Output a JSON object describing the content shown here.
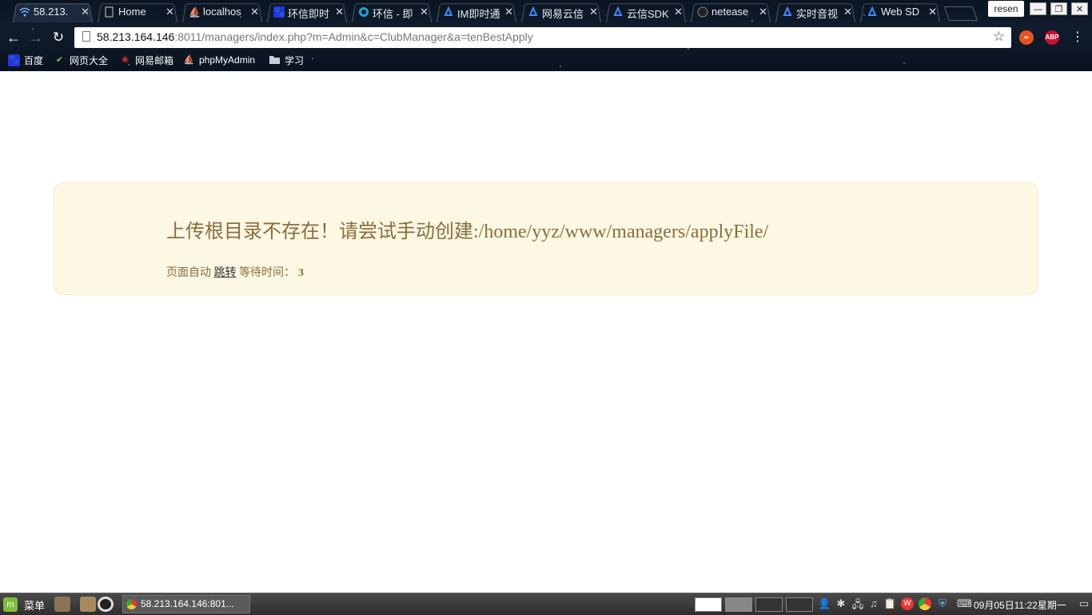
{
  "browser": {
    "tabs": [
      {
        "label": "58.213.",
        "icon": "wifi-icon",
        "active": true
      },
      {
        "label": "Home",
        "icon": "page-icon"
      },
      {
        "label": "localhos",
        "icon": "phpmyadmin-icon"
      },
      {
        "label": "环信即时",
        "icon": "paw-icon"
      },
      {
        "label": "环信 - 即",
        "icon": "easemob-icon"
      },
      {
        "label": "IM即时通",
        "icon": "netease-icon"
      },
      {
        "label": "网易云信",
        "icon": "netease-icon"
      },
      {
        "label": "云信SDK",
        "icon": "netease-icon"
      },
      {
        "label": "netease",
        "icon": "github-icon"
      },
      {
        "label": "实时音视",
        "icon": "netease-icon"
      },
      {
        "label": "Web SD",
        "icon": "netease-icon"
      }
    ],
    "user_label": "resen",
    "url_host": "58.213.164.146",
    "url_rest": ":8011/managers/index.php?m=Admin&c=ClubManager&a=tenBestApply",
    "bookmarks": [
      {
        "label": "百度",
        "icon": "baidu-icon"
      },
      {
        "label": "网页大全",
        "icon": "hao-icon"
      },
      {
        "label": "网易邮箱",
        "icon": "netease-mail-icon"
      },
      {
        "label": "phpMyAdmin",
        "icon": "phpmyadmin-icon"
      },
      {
        "label": "学习",
        "icon": "folder-icon"
      }
    ],
    "extensions": [
      "infinity-extension-icon",
      "adblock-plus-icon"
    ],
    "adblock_label": "ABP"
  },
  "page": {
    "message": "上传根目录不存在！请尝试手动创建:/home/yyz/www/managers/applyFile/",
    "redirect_prefix": "页面自动",
    "redirect_link": "跳转",
    "wait_label": "等待时间：",
    "wait_seconds": "3",
    "colors": {
      "alert_bg": "#fcf8e3",
      "alert_border": "#faebcc",
      "alert_text": "#8a6d3b"
    }
  },
  "taskbar": {
    "menu_label": "菜单",
    "window_title": "58.213.164.146:801...",
    "clock": "09月05日11:22星期一"
  }
}
